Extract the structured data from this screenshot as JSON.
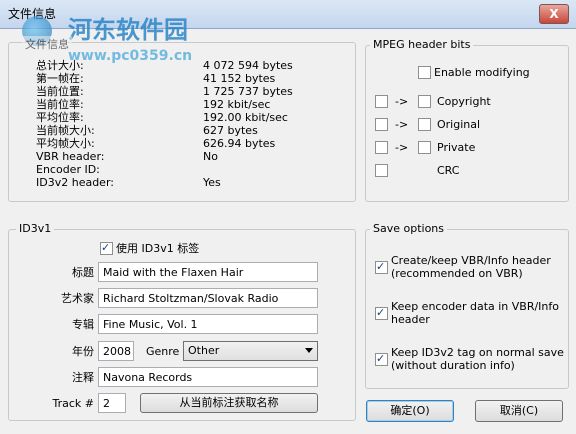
{
  "window": {
    "title": "文件信息",
    "close_glyph": "X"
  },
  "watermark": {
    "text": "河东软件园",
    "url": "www.pc0359.cn"
  },
  "file_info": {
    "group_label": "文件信息",
    "rows": [
      {
        "label": "总计大小:",
        "value": "4 072 594 bytes"
      },
      {
        "label": "第一帧在:",
        "value": "41 152 bytes"
      },
      {
        "label": "当前位置:",
        "value": "1 725 737 bytes"
      },
      {
        "label": "当前位率:",
        "value": "192 kbit/sec"
      },
      {
        "label": "平均位率:",
        "value": "192.00 kbit/sec"
      },
      {
        "label": "当前帧大小:",
        "value": "627 bytes"
      },
      {
        "label": "平均帧大小:",
        "value": "626.94 bytes"
      },
      {
        "label": "VBR header:",
        "value": "No"
      },
      {
        "label": "Encoder ID:",
        "value": ""
      },
      {
        "label": "ID3v2 header:",
        "value": "Yes"
      }
    ]
  },
  "mpeg": {
    "group_label": "MPEG header bits",
    "enable_label": "Enable modifying",
    "enable_checked": false,
    "arrow": "->",
    "bits": [
      {
        "label": "Copyright",
        "has_arrow": true
      },
      {
        "label": "Original",
        "has_arrow": true
      },
      {
        "label": "Private",
        "has_arrow": true
      },
      {
        "label": "CRC",
        "has_arrow": false
      }
    ]
  },
  "id3v1": {
    "group_label": "ID3v1",
    "use_label": "使用 ID3v1 标签",
    "use_checked": true,
    "title_label": "标题",
    "title_value": "Maid with the Flaxen Hair",
    "artist_label": "艺术家",
    "artist_value": "Richard Stoltzman/Slovak Radio",
    "album_label": "专辑",
    "album_value": "Fine Music, Vol. 1",
    "year_label": "年份",
    "year_value": "2008",
    "genre_label": "Genre",
    "genre_value": "Other",
    "comment_label": "注释",
    "comment_value": "Navona Records",
    "track_label": "Track #",
    "track_value": "2",
    "fetch_button": "从当前标注获取名称"
  },
  "save_options": {
    "group_label": "Save options",
    "options": [
      {
        "line1": "Create/keep VBR/Info header",
        "line2": "(recommended on VBR)",
        "checked": true
      },
      {
        "line1": "Keep encoder data in VBR/Info",
        "line2": "header",
        "checked": true
      },
      {
        "line1": "Keep ID3v2 tag on normal save",
        "line2": "(without duration info)",
        "checked": true
      }
    ]
  },
  "buttons": {
    "ok": "确定(O)",
    "cancel": "取消(C)"
  }
}
